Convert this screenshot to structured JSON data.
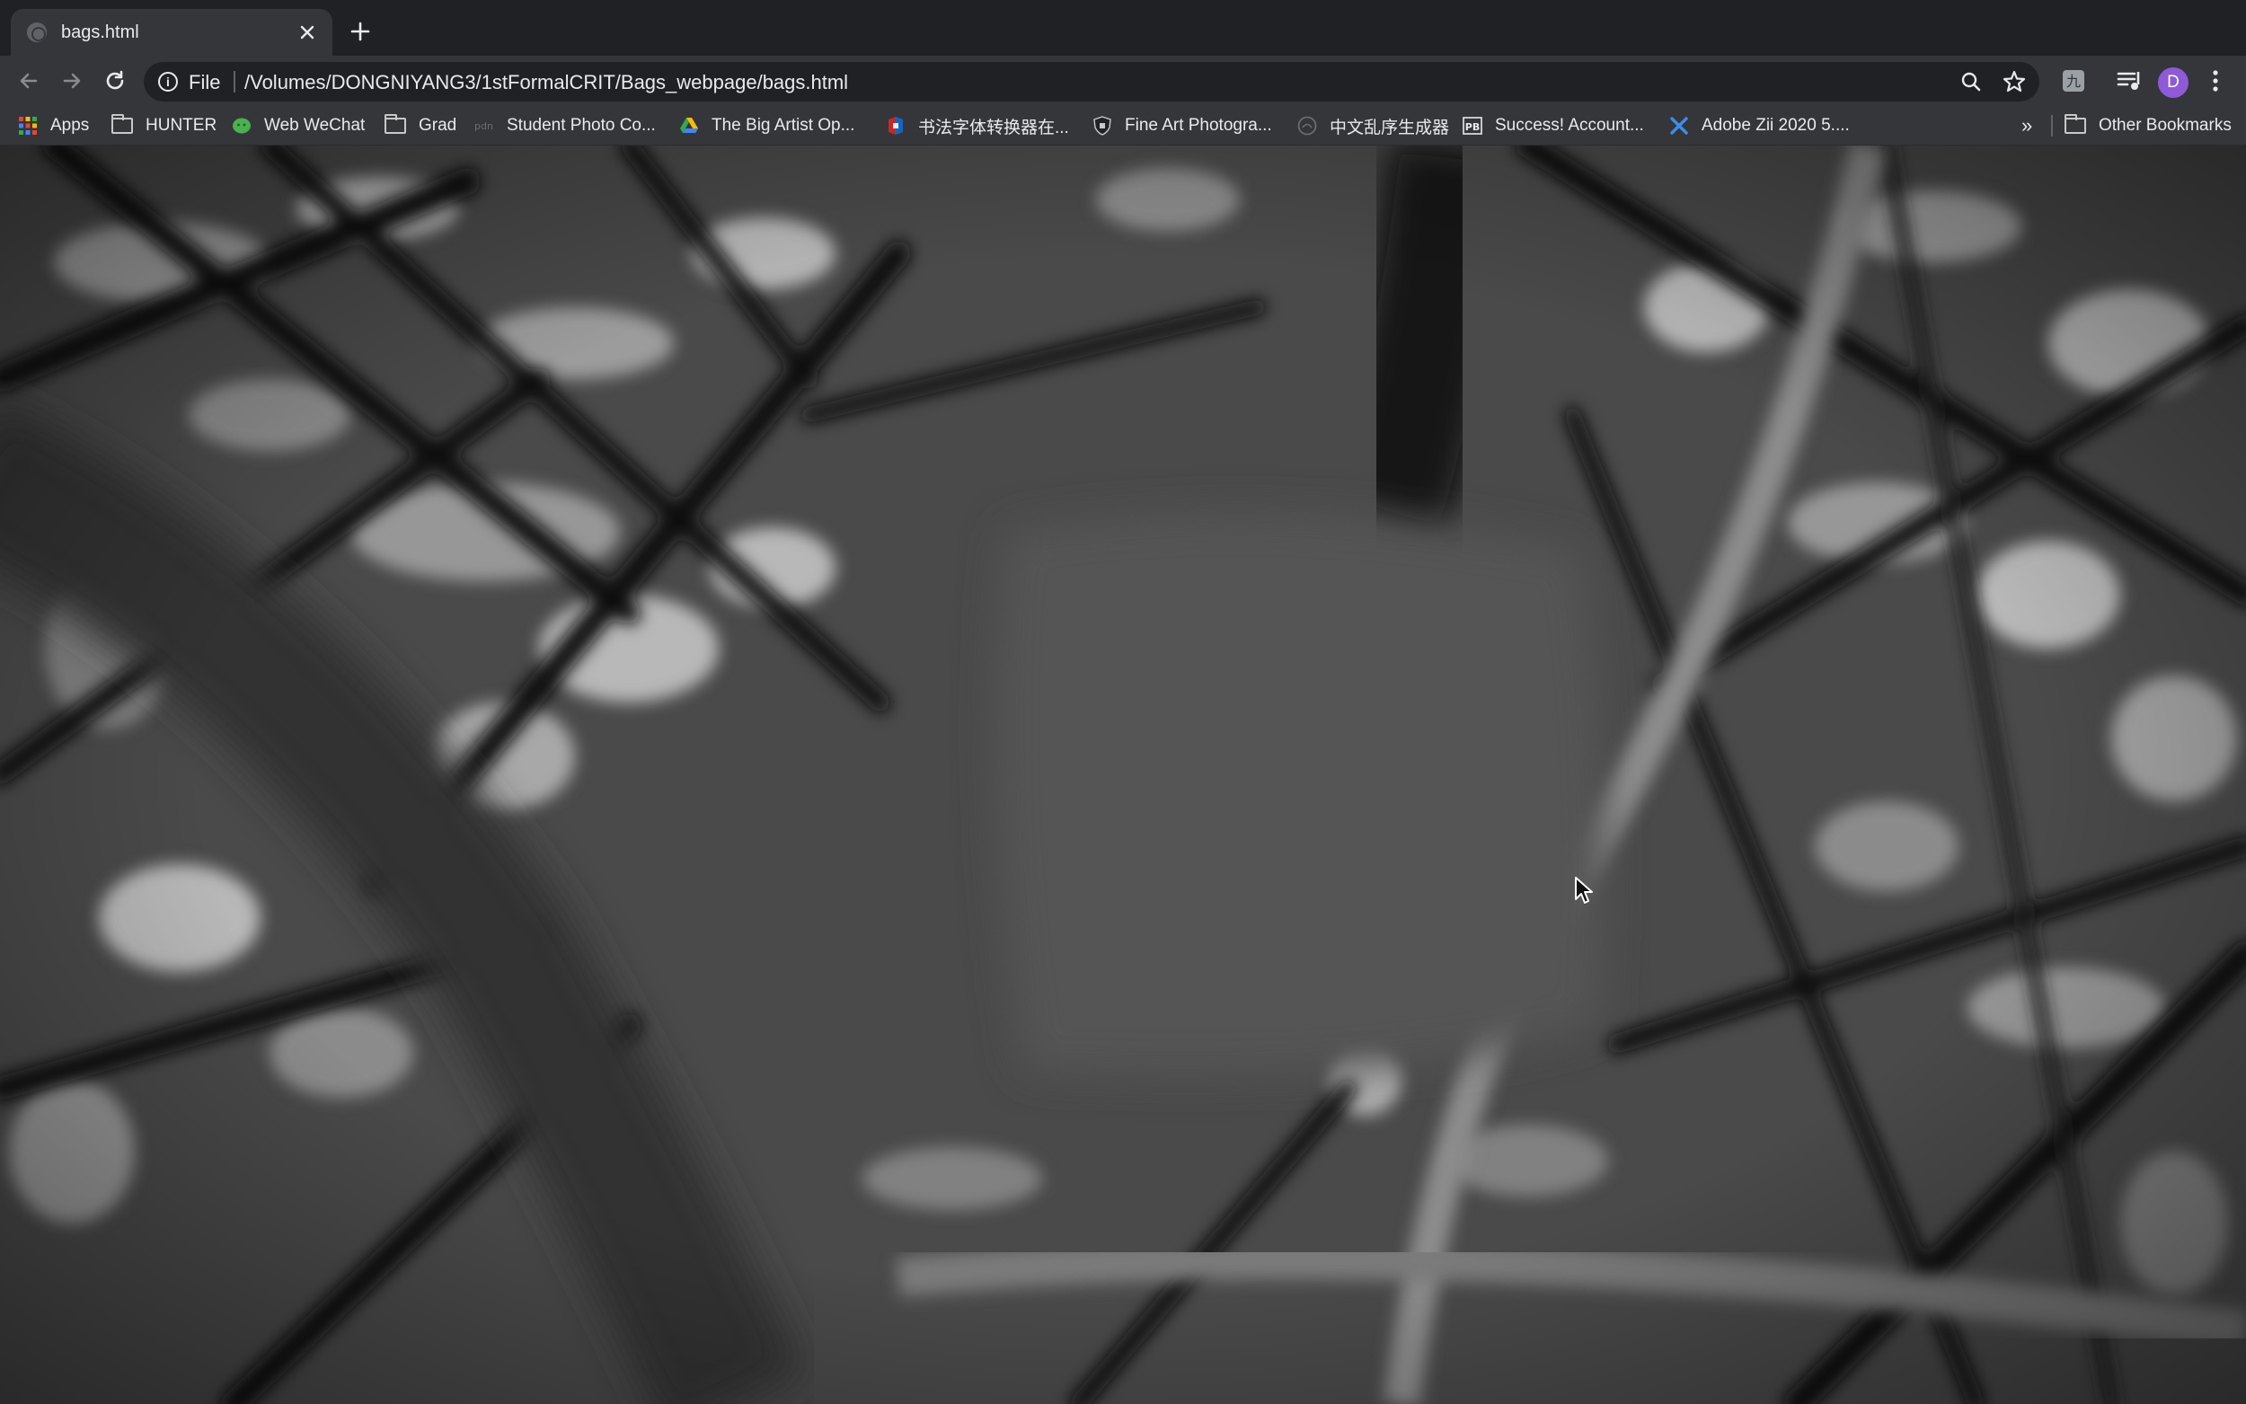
{
  "tab": {
    "title": "bags.html",
    "favicon": "globe-icon",
    "close_icon": "close-icon"
  },
  "toolbar": {
    "back_icon": "back-arrow-icon",
    "forward_icon": "forward-arrow-icon",
    "reload_icon": "reload-icon",
    "scheme": "File",
    "url": "/Volumes/DONGNIYANG3/1stFormalCRIT/Bags_webpage/bags.html",
    "zoom_icon": "magnifier-icon",
    "bookmark_star_icon": "star-icon",
    "extension_icon": "extension-icon",
    "reading_list_icon": "media-queue-icon",
    "avatar_letter": "D",
    "avatar_color": "#8e5ad8",
    "menu_icon": "more-vert-icon"
  },
  "bookmarks": {
    "items": [
      {
        "label": "Apps",
        "icon": "apps-grid-icon"
      },
      {
        "label": "HUNTER",
        "icon": "folder-icon"
      },
      {
        "label": "Web WeChat",
        "icon": "wechat-icon"
      },
      {
        "label": "Grad",
        "icon": "folder-icon"
      },
      {
        "label": "Student Photo Co...",
        "icon": "pdn-icon"
      },
      {
        "label": "The Big Artist Op...",
        "icon": "drive-icon"
      },
      {
        "label": "书法字体转换器在...",
        "icon": "calligraphy-icon"
      },
      {
        "label": "Fine Art Photogra...",
        "icon": "shield-icon"
      },
      {
        "label": "中文乱序生成器",
        "icon": "circle-logo-icon"
      },
      {
        "label": "Success! Account...",
        "icon": "pb-icon"
      },
      {
        "label": "Adobe Zii 2020 5....",
        "icon": "x-logo-icon"
      }
    ],
    "overflow": "»",
    "other_bookmarks": "Other Bookmarks"
  },
  "page": {
    "background_image": "blurred-monochrome-branches-photo",
    "accent_colors": {
      "chrome_dark": "#202124",
      "chrome_mid": "#35363a",
      "text": "#e8eaed"
    }
  }
}
